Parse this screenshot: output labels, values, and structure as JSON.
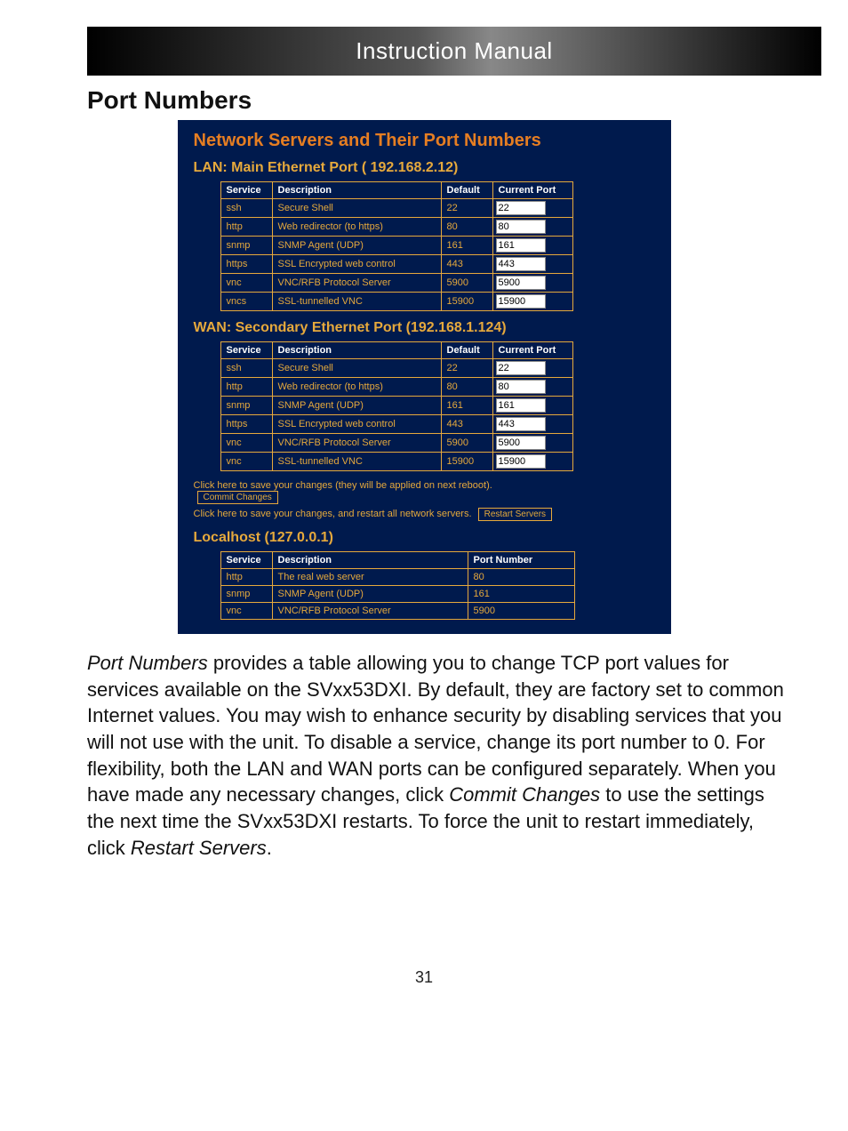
{
  "topbar_title": "Instruction Manual",
  "section_heading": "Port Numbers",
  "panel": {
    "title": "Network Servers and Their Port Numbers",
    "lan": {
      "heading": "LAN: Main Ethernet Port ( 192.168.2.12)",
      "headers": [
        "Service",
        "Description",
        "Default",
        "Current Port"
      ],
      "rows": [
        {
          "service": "ssh",
          "desc": "Secure Shell",
          "default": "22",
          "current": "22"
        },
        {
          "service": "http",
          "desc": "Web redirector (to https)",
          "default": "80",
          "current": "80"
        },
        {
          "service": "snmp",
          "desc": "SNMP Agent (UDP)",
          "default": "161",
          "current": "161"
        },
        {
          "service": "https",
          "desc": "SSL Encrypted web control",
          "default": "443",
          "current": "443"
        },
        {
          "service": "vnc",
          "desc": "VNC/RFB Protocol Server",
          "default": "5900",
          "current": "5900"
        },
        {
          "service": "vncs",
          "desc": "SSL-tunnelled VNC",
          "default": "15900",
          "current": "15900"
        }
      ]
    },
    "wan": {
      "heading": "WAN: Secondary Ethernet Port (192.168.1.124)",
      "headers": [
        "Service",
        "Description",
        "Default",
        "Current Port"
      ],
      "rows": [
        {
          "service": "ssh",
          "desc": "Secure Shell",
          "default": "22",
          "current": "22"
        },
        {
          "service": "http",
          "desc": "Web redirector (to https)",
          "default": "80",
          "current": "80"
        },
        {
          "service": "snmp",
          "desc": "SNMP Agent (UDP)",
          "default": "161",
          "current": "161"
        },
        {
          "service": "https",
          "desc": "SSL Encrypted web control",
          "default": "443",
          "current": "443"
        },
        {
          "service": "vnc",
          "desc": "VNC/RFB Protocol Server",
          "default": "5900",
          "current": "5900"
        },
        {
          "service": "vnc",
          "desc": "SSL-tunnelled VNC",
          "default": "15900",
          "current": "15900"
        }
      ]
    },
    "commit_hint": "Click here to save your changes (they will be applied on next reboot).",
    "commit_button": "Commit Changes",
    "restart_hint": "Click here to save your changes, and restart all network servers.",
    "restart_button": "Restart Servers",
    "localhost": {
      "heading": "Localhost (127.0.0.1)",
      "headers": [
        "Service",
        "Description",
        "Port Number"
      ],
      "rows": [
        {
          "service": "http",
          "desc": "The real web server",
          "port": "80"
        },
        {
          "service": "snmp",
          "desc": "SNMP Agent (UDP)",
          "port": "161"
        },
        {
          "service": "vnc",
          "desc": "VNC/RFB Protocol Server",
          "port": "5900"
        }
      ]
    }
  },
  "body_text_pre": "Port Numbers",
  "body_text_mid1": " provides a table allowing you to change TCP port values for services available on the SVxx53DXI. By default, they are factory set to common Internet values. You may wish to enhance security by disabling services that you will not use with the unit. To disable a service, change its port number to 0. For flexibility, both the LAN and WAN ports can be configured separately. When you have made any necessary changes, click ",
  "body_text_commit": "Commit Changes",
  "body_text_mid2": " to use the settings the next time the SVxx53DXI restarts. To force the unit to restart immediately, click ",
  "body_text_restart": "Restart Servers",
  "body_text_end": ".",
  "page_number": "31"
}
